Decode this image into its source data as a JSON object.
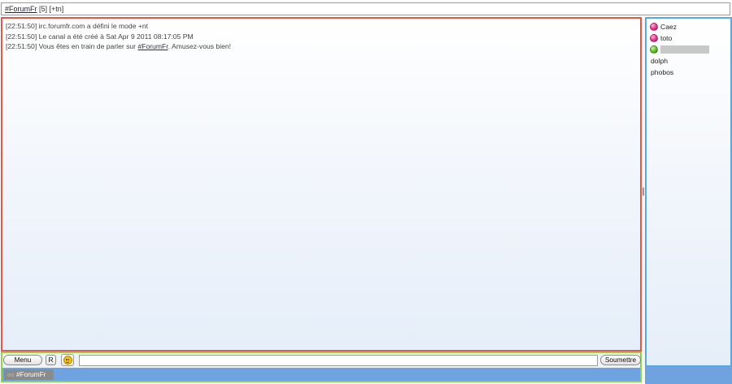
{
  "topic": {
    "channel_link": "#ForumFr",
    "suffix": " [5] [+tn]"
  },
  "messages": [
    {
      "text": "[22:51:50] irc.forumfr.com a défini le mode +nt"
    },
    {
      "text": "[22:51:50] Le canal a été créé à Sat Apr 9 2011 08:17:05 PM"
    },
    {
      "pre": "[22:51:50] Vous êtes en train de parler sur ",
      "link": "#ForumFr",
      "post": ". Amusez-vous bien!"
    }
  ],
  "nicklist": [
    {
      "status": "op",
      "name": "Caez"
    },
    {
      "status": "op",
      "name": "toto"
    },
    {
      "status": "voice",
      "name": "",
      "redacted": true
    },
    {
      "status": "none",
      "name": "dolph"
    },
    {
      "status": "none",
      "name": "phobos"
    }
  ],
  "toolbar": {
    "menu_label": "Menu",
    "r_label": "R",
    "smiley_icon": "smiley-icon",
    "input_value": "",
    "input_placeholder": "",
    "submit_label": "Soumettre"
  },
  "tabs": [
    {
      "label": "#ForumFr",
      "icon": "channel-icon"
    }
  ],
  "colors": {
    "chat_border": "#e2584b",
    "nicklist_border": "#5aa7e6",
    "bottom_border": "#8fd14f",
    "bottom_bg": "#6fa3df",
    "op_dot": "#e0338a",
    "voice_dot": "#5fbb2d"
  }
}
